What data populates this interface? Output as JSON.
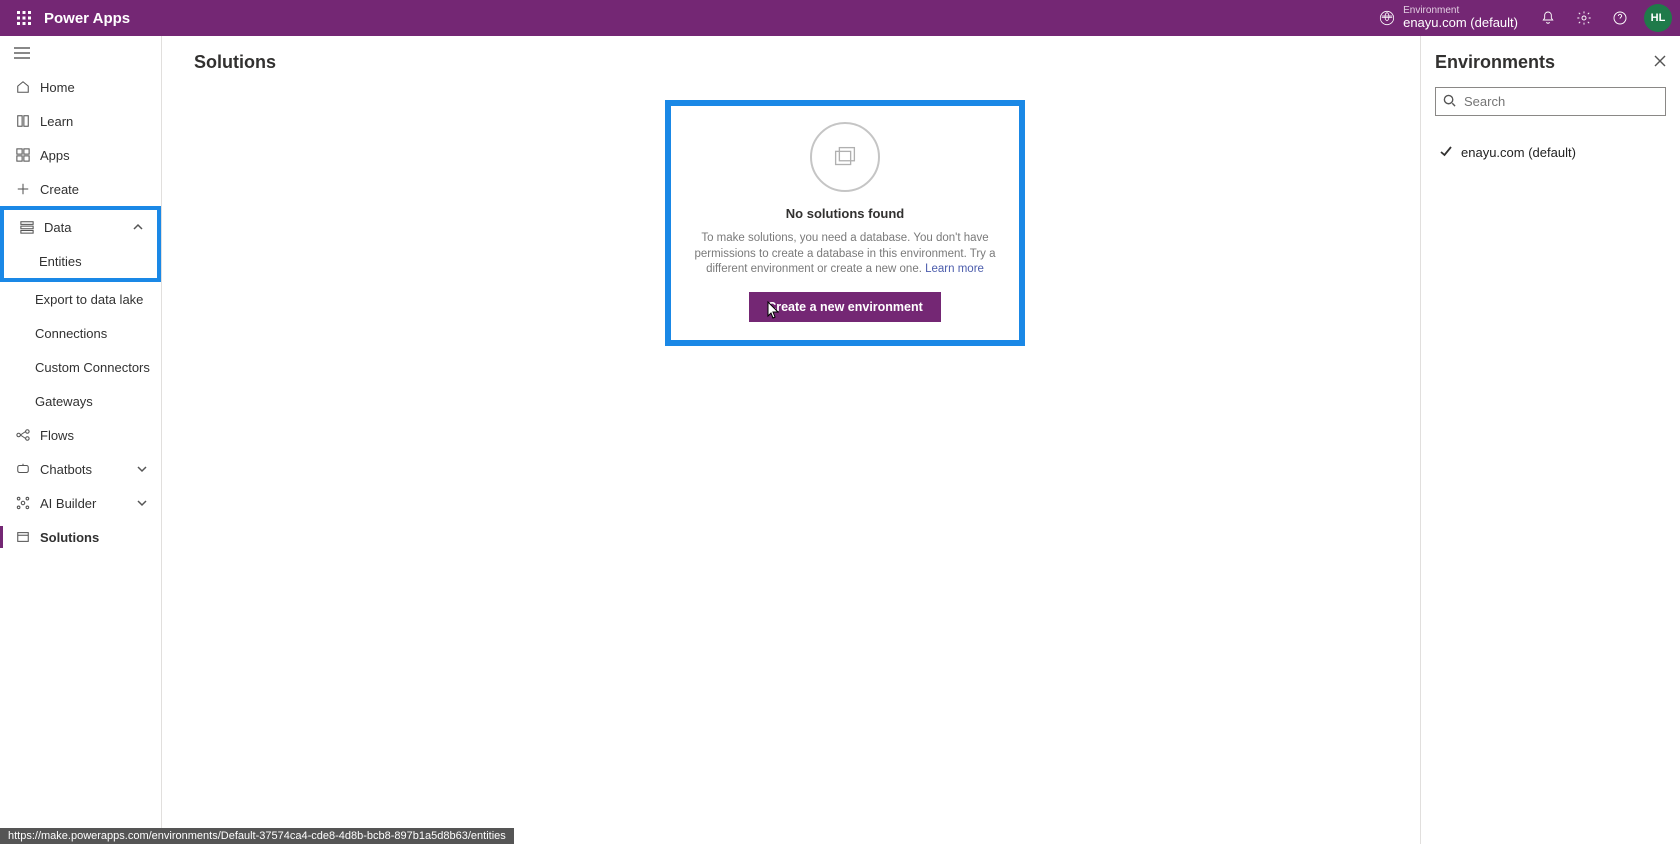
{
  "header": {
    "brand": "Power Apps",
    "env_label": "Environment",
    "env_name": "enayu.com (default)",
    "avatar_initials": "HL"
  },
  "sidebar": {
    "home": "Home",
    "learn": "Learn",
    "apps": "Apps",
    "create": "Create",
    "data": "Data",
    "data_children": {
      "entities": "Entities",
      "export": "Export to data lake",
      "connections": "Connections",
      "custom_connectors": "Custom Connectors",
      "gateways": "Gateways"
    },
    "flows": "Flows",
    "chatbots": "Chatbots",
    "ai_builder": "AI Builder",
    "solutions": "Solutions"
  },
  "main": {
    "page_title": "Solutions",
    "empty_title": "No solutions found",
    "empty_desc": "To make solutions, you need a database. You don't have permissions to create a database in this environment. Try a different environment or create a new one. ",
    "learn_more": "Learn more",
    "create_env_button": "Create a new environment"
  },
  "rpanel": {
    "title": "Environments",
    "search_placeholder": "Search",
    "env_item": "enayu.com (default)"
  },
  "status_url": "https://make.powerapps.com/environments/Default-37574ca4-cde8-4d8b-bcb8-897b1a5d8b63/entities"
}
